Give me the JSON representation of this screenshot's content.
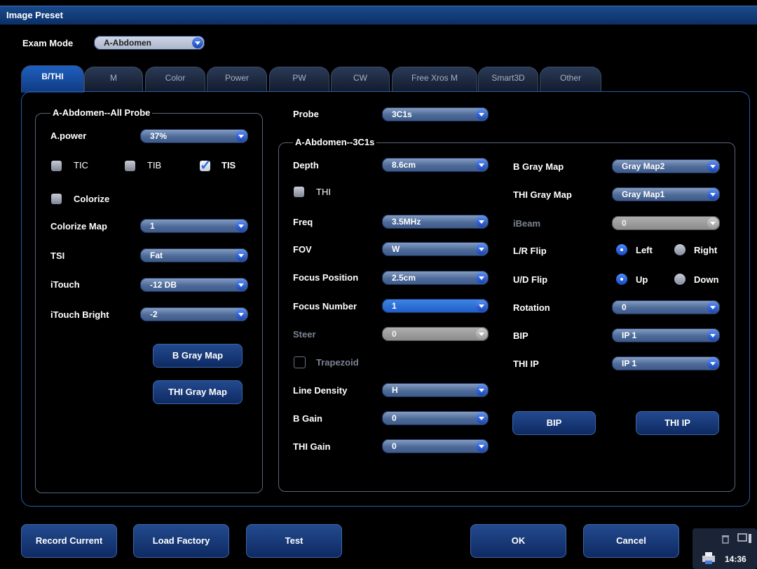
{
  "title": "Image Preset",
  "exam_mode": {
    "label": "Exam Mode",
    "value": "A-Abdomen"
  },
  "tabs": [
    "B/THI",
    "M",
    "Color",
    "Power",
    "PW",
    "CW",
    "Free Xros M",
    "Smart3D",
    "Other"
  ],
  "left_group": {
    "title": "A-Abdomen--All Probe",
    "apower": {
      "label": "A.power",
      "value": "37%"
    },
    "tic": "TIC",
    "tib": "TIB",
    "tis": "TIS",
    "colorize": "Colorize",
    "colorize_map": {
      "label": "Colorize Map",
      "value": "1"
    },
    "tsi": {
      "label": "TSI",
      "value": "Fat"
    },
    "itouch": {
      "label": "iTouch",
      "value": "-12 DB"
    },
    "itouch_bright": {
      "label": "iTouch Bright",
      "value": "-2"
    },
    "bgray_btn": "B Gray Map",
    "thigray_btn": "THI Gray Map"
  },
  "probe": {
    "label": "Probe",
    "value": "3C1s"
  },
  "right_group": {
    "title": "A-Abdomen--3C1s",
    "depth": {
      "label": "Depth",
      "value": "8.6cm"
    },
    "thi": "THI",
    "freq": {
      "label": "Freq",
      "value": "3.5MHz"
    },
    "fov": {
      "label": "FOV",
      "value": "W"
    },
    "focus_pos": {
      "label": "Focus Position",
      "value": "2.5cm"
    },
    "focus_num": {
      "label": "Focus Number",
      "value": "1"
    },
    "steer": {
      "label": "Steer",
      "value": "0"
    },
    "trapezoid": "Trapezoid",
    "line_density": {
      "label": "Line Density",
      "value": "H"
    },
    "bgain": {
      "label": "B Gain",
      "value": "0"
    },
    "thigain": {
      "label": "THI Gain",
      "value": "0"
    },
    "bgraymap": {
      "label": "B Gray Map",
      "value": "Gray Map2"
    },
    "thigraymap": {
      "label": "THI Gray Map",
      "value": "Gray Map1"
    },
    "ibeam": {
      "label": "iBeam",
      "value": "0"
    },
    "lr_flip": {
      "label": "L/R Flip",
      "opt1": "Left",
      "opt2": "Right"
    },
    "ud_flip": {
      "label": "U/D Flip",
      "opt1": "Up",
      "opt2": "Down"
    },
    "rotation": {
      "label": "Rotation",
      "value": "0"
    },
    "bip": {
      "label": "BIP",
      "value": "IP 1"
    },
    "thiip": {
      "label": "THI IP",
      "value": "IP 1"
    },
    "bip_btn": "BIP",
    "thiip_btn": "THI IP"
  },
  "footer": {
    "record": "Record Current",
    "load": "Load Factory",
    "test": "Test",
    "ok": "OK",
    "cancel": "Cancel"
  },
  "clock": "14:36"
}
